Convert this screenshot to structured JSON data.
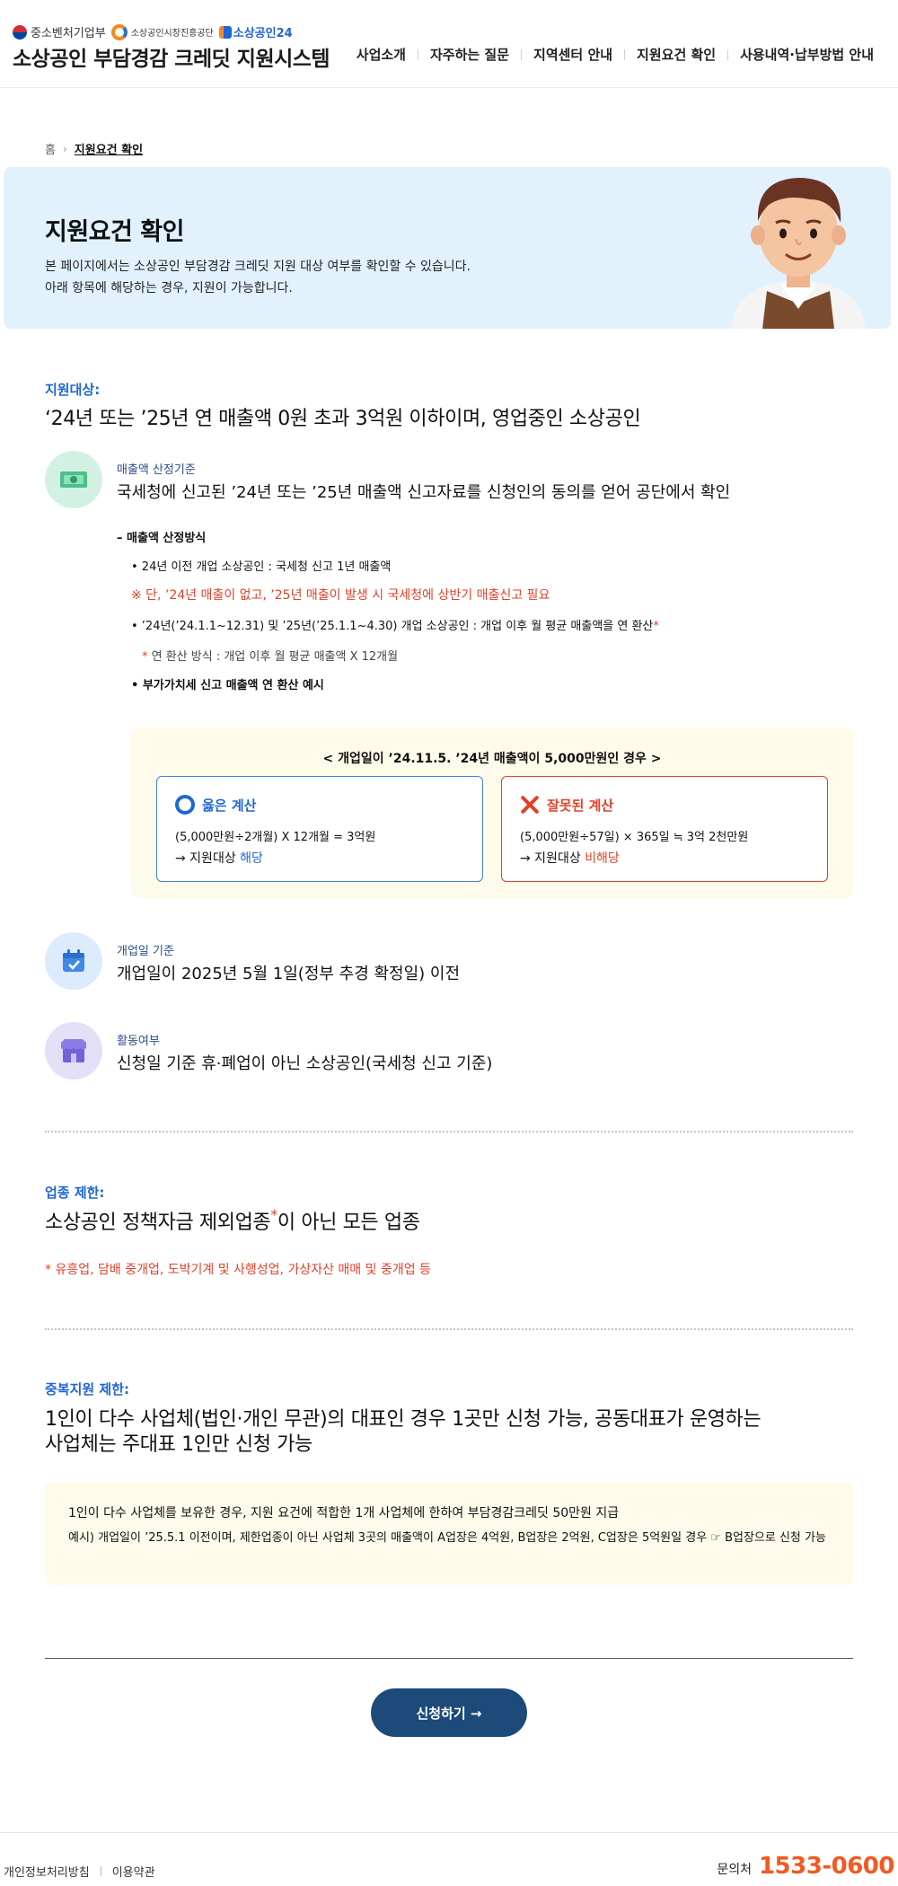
{
  "header": {
    "org1": "중소벤처기업부",
    "org2": "소상공인시장진흥공단",
    "org3": "소상공인24",
    "title": "소상공인 부담경감 크레딧 지원시스템",
    "nav": [
      "사업소개",
      "자주하는 질문",
      "지역센터 안내",
      "지원요건 확인",
      "사용내역·납부방법 안내"
    ]
  },
  "breadcrumb": {
    "home": "홈",
    "current": "지원요건 확인"
  },
  "hero": {
    "title": "지원요건 확인",
    "desc1": "본 페이지에서는 소상공인 부담경감 크레딧 지원 대상 여부를 확인할 수 있습니다.",
    "desc2": "아래 항목에 해당하는 경우, 지원이 가능합니다."
  },
  "target": {
    "label": "지원대상:",
    "title": "‘24년 또는 ’25년 연 매출액 0원 초과 3억원 이하이며, 영업중인 소상공인"
  },
  "sales": {
    "label": "매출액 산정기준",
    "text": "국세청에 신고된 ’24년 또는 ’25년 매출액 신고자료를 신청인의 동의를 얻어 공단에서 확인",
    "method_head": "– 매출액 산정방식",
    "m1": "•  24년 이전 개업 소상공인 : 국세청 신고 1년 매출액",
    "m2": "※ 단, ’24년 매출이 없고, ’25년 매출이 발생 시 국세청에 상반기 매출신고 필요",
    "m3": "•  ’24년(’24.1.1~12.31) 및 ’25년(’25.1.1~4.30) 개업 소상공인 : 개업 이후 월 평균 매출액을 연 환산",
    "m4_star": "*",
    "m4": " 연 환산 방식 : 개업 이후 월 평균 매출액 X 12개월",
    "m5": "•  부가가치세 신고 매출액 연 환산 예시"
  },
  "example": {
    "title": "< 개업일이 ’24.11.5. ’24년 매출액이 5,000만원인 경우 >",
    "ok": {
      "head": "옳은 계산",
      "formula": "(5,000만원÷2개월) X 12개월 = 3억원",
      "result_prefix": "→ 지원대상 ",
      "result_hl": "해당"
    },
    "bad": {
      "head": "잘못된 계산",
      "formula": "(5,000만원÷57일) × 365일 ≒ 3억 2천만원",
      "result_prefix": "→ 지원대상 ",
      "result_hl": "비해당"
    }
  },
  "open_date": {
    "label": "개업일 기준",
    "text": "개업일이 2025년 5월 1일(정부 추경 확정일) 이전"
  },
  "activity": {
    "label": "활동여부",
    "text": "신청일 기준 휴·폐업이 아닌 소상공인(국세청 신고 기준)"
  },
  "industry": {
    "label": "업종 제한:",
    "title_a": "소상공인 정책자금 제외업종",
    "title_star": "*",
    "title_b": "이 아닌 모든 업종",
    "note": "* 유흥업, 담배 중개업, 도박기계 및 사행성업, 가상자산 매매 및 중개업 등"
  },
  "duplicate": {
    "label": "중복지원 제한:",
    "title1": "1인이 다수 사업체(법인·개인 무관)의 대표인 경우 1곳만 신청 가능, 공동대표가 운영하는",
    "title2": "사업체는 주대표 1인만 신청 가능",
    "info1": "1인이 다수 사업체를 보유한 경우, 지원 요건에 적합한 1개 사업체에 한하여 부담경감크레딧 50만원 지급",
    "info2": "예시) 개업일이 ’25.5.1 이전이며, 제한업종이 아닌 사업체 3곳의 매출액이 A업장은 4억원, B업장은 2억원, C업장은 5억원일 경우 ☞ B업장으로 신청 가능"
  },
  "apply_button": "신청하기 →",
  "footer": {
    "privacy": "개인정보처리방침",
    "terms": "이용약관",
    "contact_label": "문의처",
    "contact_number": "1533-0600"
  }
}
